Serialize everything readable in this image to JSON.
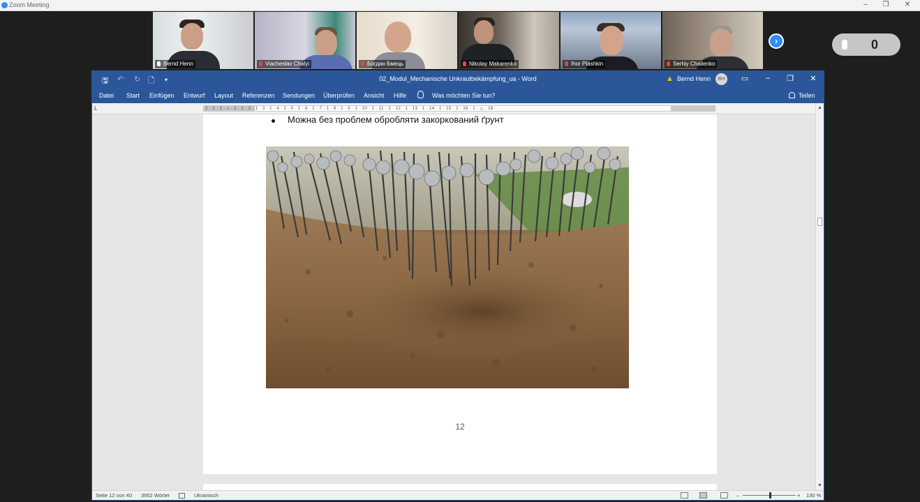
{
  "zoom": {
    "window_title": "Zoom Meeting",
    "window_controls": [
      "–",
      "❐",
      "✕"
    ],
    "participants": [
      {
        "name": "Bernd Henn",
        "muted": false
      },
      {
        "name": "Viacheslav Chalyi",
        "muted": true
      },
      {
        "name": "Богдан Бмець",
        "muted": true
      },
      {
        "name": "Nikolay Makarenko",
        "muted": true
      },
      {
        "name": "Ihor Plashkin",
        "muted": true
      },
      {
        "name": "Serhiy Chalienko",
        "muted": true
      }
    ],
    "next_page_symbol": "›",
    "raised_count": "0"
  },
  "word": {
    "doc_title": "02_Modul_Mechanische Unkrautbekämpfung_ua  -  Word",
    "user_name": "Bernd Henn",
    "user_initials": "BH",
    "quick_access": [
      "🖫",
      "↶",
      "↻",
      "🗋"
    ],
    "window_controls": [
      "▭",
      "–",
      "❐",
      "✕"
    ],
    "ribbon_tabs": [
      "Datei",
      "Start",
      "Einfügen",
      "Entwurf",
      "Layout",
      "Referenzen",
      "Sendungen",
      "Überprüfen",
      "Ansicht",
      "Hilfe"
    ],
    "tell_me": "Was möchten Sie tun?",
    "share": "Teilen",
    "ruler_corner": "L",
    "ruler_ticks": "2 · 1 · 1 · ⌂ · 1 · 1 · 2 · 1 · 3 · 1 · 4 · 1 · 5 · 1 · 6 · 1 · 7 · 1 · 8 · 1 · 9 · 1 · 10 · 1 · 11 · 1 · 12 · 1 · 13 · 1 · 14 · 1 · 15 · 1 · 16 · 1 · △ · 18 ·",
    "bullet_text": "Можна без проблем обробляти закоркований ґрунт",
    "page_number": "12",
    "status": {
      "page": "Seite 12 von 40",
      "words": "3952 Wörter",
      "language": "Ukrainisch",
      "zoom_minus": "–",
      "zoom_plus": "+",
      "zoom_level": "130 %"
    }
  }
}
